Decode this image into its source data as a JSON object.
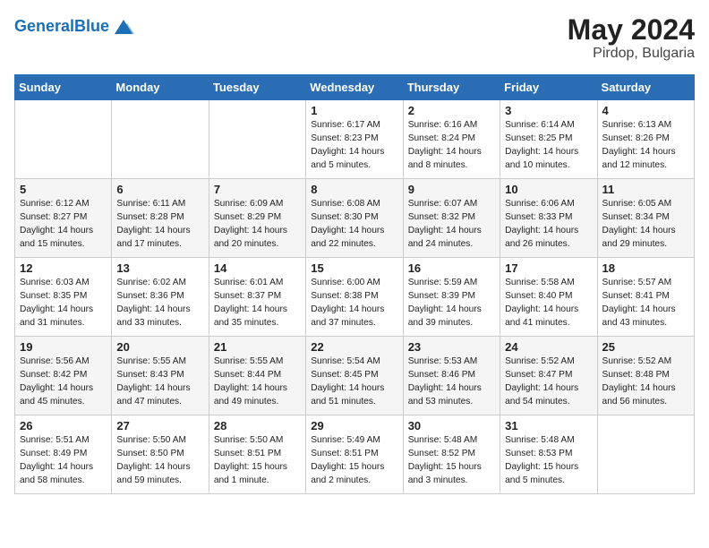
{
  "header": {
    "logo_general": "General",
    "logo_blue": "Blue",
    "month_year": "May 2024",
    "location": "Pirdop, Bulgaria"
  },
  "weekdays": [
    "Sunday",
    "Monday",
    "Tuesday",
    "Wednesday",
    "Thursday",
    "Friday",
    "Saturday"
  ],
  "weeks": [
    [
      {
        "day": "",
        "content": ""
      },
      {
        "day": "",
        "content": ""
      },
      {
        "day": "",
        "content": ""
      },
      {
        "day": "1",
        "content": "Sunrise: 6:17 AM\nSunset: 8:23 PM\nDaylight: 14 hours\nand 5 minutes."
      },
      {
        "day": "2",
        "content": "Sunrise: 6:16 AM\nSunset: 8:24 PM\nDaylight: 14 hours\nand 8 minutes."
      },
      {
        "day": "3",
        "content": "Sunrise: 6:14 AM\nSunset: 8:25 PM\nDaylight: 14 hours\nand 10 minutes."
      },
      {
        "day": "4",
        "content": "Sunrise: 6:13 AM\nSunset: 8:26 PM\nDaylight: 14 hours\nand 12 minutes."
      }
    ],
    [
      {
        "day": "5",
        "content": "Sunrise: 6:12 AM\nSunset: 8:27 PM\nDaylight: 14 hours\nand 15 minutes."
      },
      {
        "day": "6",
        "content": "Sunrise: 6:11 AM\nSunset: 8:28 PM\nDaylight: 14 hours\nand 17 minutes."
      },
      {
        "day": "7",
        "content": "Sunrise: 6:09 AM\nSunset: 8:29 PM\nDaylight: 14 hours\nand 20 minutes."
      },
      {
        "day": "8",
        "content": "Sunrise: 6:08 AM\nSunset: 8:30 PM\nDaylight: 14 hours\nand 22 minutes."
      },
      {
        "day": "9",
        "content": "Sunrise: 6:07 AM\nSunset: 8:32 PM\nDaylight: 14 hours\nand 24 minutes."
      },
      {
        "day": "10",
        "content": "Sunrise: 6:06 AM\nSunset: 8:33 PM\nDaylight: 14 hours\nand 26 minutes."
      },
      {
        "day": "11",
        "content": "Sunrise: 6:05 AM\nSunset: 8:34 PM\nDaylight: 14 hours\nand 29 minutes."
      }
    ],
    [
      {
        "day": "12",
        "content": "Sunrise: 6:03 AM\nSunset: 8:35 PM\nDaylight: 14 hours\nand 31 minutes."
      },
      {
        "day": "13",
        "content": "Sunrise: 6:02 AM\nSunset: 8:36 PM\nDaylight: 14 hours\nand 33 minutes."
      },
      {
        "day": "14",
        "content": "Sunrise: 6:01 AM\nSunset: 8:37 PM\nDaylight: 14 hours\nand 35 minutes."
      },
      {
        "day": "15",
        "content": "Sunrise: 6:00 AM\nSunset: 8:38 PM\nDaylight: 14 hours\nand 37 minutes."
      },
      {
        "day": "16",
        "content": "Sunrise: 5:59 AM\nSunset: 8:39 PM\nDaylight: 14 hours\nand 39 minutes."
      },
      {
        "day": "17",
        "content": "Sunrise: 5:58 AM\nSunset: 8:40 PM\nDaylight: 14 hours\nand 41 minutes."
      },
      {
        "day": "18",
        "content": "Sunrise: 5:57 AM\nSunset: 8:41 PM\nDaylight: 14 hours\nand 43 minutes."
      }
    ],
    [
      {
        "day": "19",
        "content": "Sunrise: 5:56 AM\nSunset: 8:42 PM\nDaylight: 14 hours\nand 45 minutes."
      },
      {
        "day": "20",
        "content": "Sunrise: 5:55 AM\nSunset: 8:43 PM\nDaylight: 14 hours\nand 47 minutes."
      },
      {
        "day": "21",
        "content": "Sunrise: 5:55 AM\nSunset: 8:44 PM\nDaylight: 14 hours\nand 49 minutes."
      },
      {
        "day": "22",
        "content": "Sunrise: 5:54 AM\nSunset: 8:45 PM\nDaylight: 14 hours\nand 51 minutes."
      },
      {
        "day": "23",
        "content": "Sunrise: 5:53 AM\nSunset: 8:46 PM\nDaylight: 14 hours\nand 53 minutes."
      },
      {
        "day": "24",
        "content": "Sunrise: 5:52 AM\nSunset: 8:47 PM\nDaylight: 14 hours\nand 54 minutes."
      },
      {
        "day": "25",
        "content": "Sunrise: 5:52 AM\nSunset: 8:48 PM\nDaylight: 14 hours\nand 56 minutes."
      }
    ],
    [
      {
        "day": "26",
        "content": "Sunrise: 5:51 AM\nSunset: 8:49 PM\nDaylight: 14 hours\nand 58 minutes."
      },
      {
        "day": "27",
        "content": "Sunrise: 5:50 AM\nSunset: 8:50 PM\nDaylight: 14 hours\nand 59 minutes."
      },
      {
        "day": "28",
        "content": "Sunrise: 5:50 AM\nSunset: 8:51 PM\nDaylight: 15 hours\nand 1 minute."
      },
      {
        "day": "29",
        "content": "Sunrise: 5:49 AM\nSunset: 8:51 PM\nDaylight: 15 hours\nand 2 minutes."
      },
      {
        "day": "30",
        "content": "Sunrise: 5:48 AM\nSunset: 8:52 PM\nDaylight: 15 hours\nand 3 minutes."
      },
      {
        "day": "31",
        "content": "Sunrise: 5:48 AM\nSunset: 8:53 PM\nDaylight: 15 hours\nand 5 minutes."
      },
      {
        "day": "",
        "content": ""
      }
    ]
  ]
}
